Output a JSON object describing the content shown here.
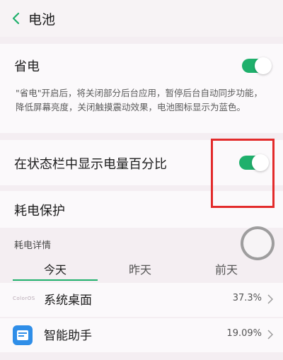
{
  "header": {
    "title": "电池"
  },
  "power_saving": {
    "label": "省电",
    "enabled": true,
    "description": "\"省电\"开启后，将关闭部分后台应用，暂停后台自动同步功能，降低屏幕亮度，关闭触摸震动效果，电池图标显示为蓝色。"
  },
  "battery_percentage": {
    "label": "在状态栏中显示电量百分比",
    "enabled": true
  },
  "power_protection": {
    "label": "耗电保护"
  },
  "details": {
    "section_title": "耗电详情",
    "tabs": [
      {
        "label": "今天",
        "active": true
      },
      {
        "label": "昨天",
        "active": false
      },
      {
        "label": "前天",
        "active": false
      }
    ],
    "apps": [
      {
        "icon": "launcher-icon",
        "icon_text": "ColorOS",
        "name": "系统桌面",
        "percent": "37.3%"
      },
      {
        "icon": "assistant-icon",
        "name": "智能助手",
        "percent": "19.09%"
      }
    ]
  },
  "colors": {
    "accent": "#1fb06c",
    "highlight_box": "#e32b2b"
  }
}
